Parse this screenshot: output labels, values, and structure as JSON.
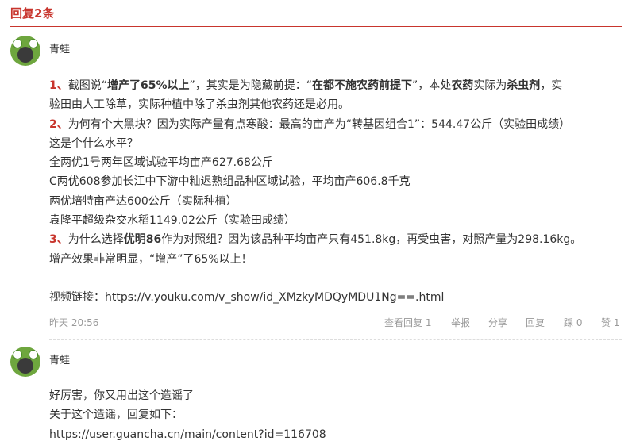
{
  "header": {
    "title": "回复2条"
  },
  "comments": [
    {
      "username": "青蛙",
      "lines": {
        "l1a": "1、",
        "l1b": "截图说“",
        "l1c": "增产了65%以上",
        "l1d": "”，其实是为隐藏前提：“",
        "l1e": "在都不施农药前提下",
        "l1f": "”，本处",
        "l1g": "农药",
        "l1h": "实际为",
        "l1i": "杀虫剂",
        "l1j": "，实",
        "l2": "验田由人工除草，实际种植中除了杀虫剂其他农药还是必用。",
        "l3a": "2、",
        "l3b": "为何有个大黑块？因为实际产量有点寒酸：最高的亩产为“转基因组合1”：544.47公斤（实验田成绩）",
        "l4": "这是个什么水平？",
        "l5": "全两优1号两年区域试验平均亩产627.68公斤",
        "l6": "C两优608参加长江中下游中籼迟熟组品种区域试验，平均亩产606.8千克",
        "l7": "两优培特亩产达600公斤（实际种植）",
        "l8": "袁隆平超级杂交水稻1149.02公斤（实验田成绩）",
        "l9a": "3、",
        "l9b": "为什么选择",
        "l9c": "优明86",
        "l9d": "作为对照组？因为该品种平均亩产只有451.8kg，再受虫害，对照产量为298.16kg。",
        "l10": "增产效果非常明显，“增产”了65%以上！",
        "l11": "视频链接：https://v.youku.com/v_show/id_XMzkyMDQyMDU1Ng==.html"
      },
      "time": "昨天 20:56",
      "actions": {
        "view_replies": "查看回复 1",
        "report": "举报",
        "share": "分享",
        "reply": "回复",
        "dislike": "踩 0",
        "like": "赞 1"
      }
    },
    {
      "username": "青蛙",
      "lines": {
        "l1": "好厉害，你又用出这个造谣了",
        "l2": "关于这个造谣，回复如下：",
        "l3": "https://user.guancha.cn/main/content?id=116708"
      }
    }
  ]
}
